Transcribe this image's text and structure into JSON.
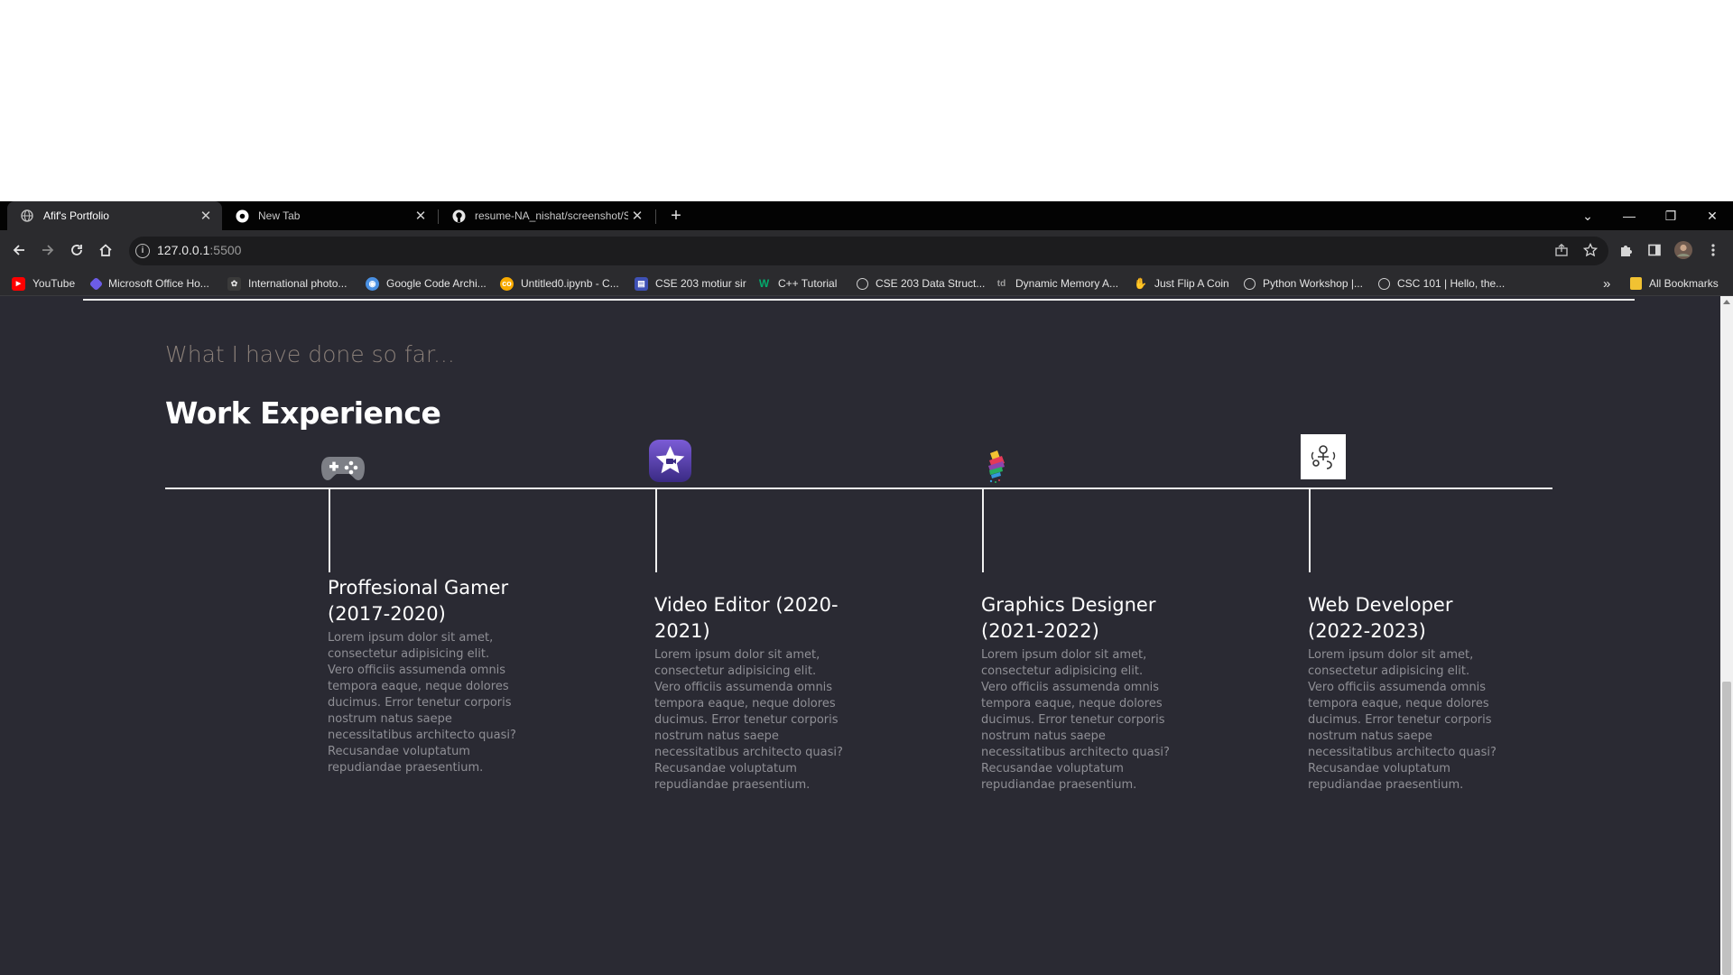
{
  "browser": {
    "tabs": [
      {
        "label": "Afif's Portfolio",
        "icon": "globe-icon",
        "active": true
      },
      {
        "label": "New Tab",
        "icon": "chrome-icon",
        "active": false
      },
      {
        "label": "resume-NA_nishat/screenshot/S",
        "icon": "github-icon",
        "active": false
      }
    ],
    "new_tab_symbol": "+",
    "window_controls": {
      "tab_search": "⌄",
      "minimize": "—",
      "restore": "❐",
      "close": "✕"
    },
    "url_host": "127.0.0.1",
    "url_port": ":5500",
    "bookmarks": [
      {
        "label": "YouTube",
        "icon": "youtube-icon",
        "color": "#ff0000"
      },
      {
        "label": "Microsoft Office Ho...",
        "icon": "office-icon",
        "color": "#6c5ce7"
      },
      {
        "label": "International photo...",
        "icon": "photo-icon",
        "color": "#444444"
      },
      {
        "label": "Google Code Archi...",
        "icon": "code-archive-icon",
        "color": "#4a90e2"
      },
      {
        "label": "Untitled0.ipynb - C...",
        "icon": "colab-icon",
        "color": "#f9ab00"
      },
      {
        "label": "CSE 203 motiur sir",
        "icon": "doc-icon",
        "color": "#3f51b5"
      },
      {
        "label": "C++ Tutorial",
        "icon": "w3-icon",
        "color": "#04aa6d"
      },
      {
        "label": "CSE 203 Data Struct...",
        "icon": "globe-icon",
        "color": "#cfcfcf"
      },
      {
        "label": "Dynamic Memory A...",
        "icon": "td-icon",
        "color": "#9e9e9e"
      },
      {
        "label": "Just Flip A Coin",
        "icon": "coin-icon",
        "color": "#f5b041"
      },
      {
        "label": "Python Workshop |...",
        "icon": "globe-icon",
        "color": "#cfcfcf"
      },
      {
        "label": "CSC 101 | Hello, the...",
        "icon": "globe-icon",
        "color": "#cfcfcf"
      }
    ],
    "bookmarks_overflow": "»",
    "all_bookmarks": "All Bookmarks"
  },
  "page": {
    "subtitle": "What I have done so far...",
    "title": "Work Experience",
    "experiences": [
      {
        "role_line1": "Proffesional Gamer",
        "role_line2": "(2017-2020)",
        "icon": "gamepad-icon",
        "description": "Lorem ipsum dolor sit amet, consectetur adipisicing elit. Vero officiis assumenda omnis tempora eaque, neque dolores ducimus. Error tenetur corporis nostrum natus saepe necessitatibus architecto quasi? Recusandae voluptatum repudiandae praesentium."
      },
      {
        "role_line1": "Video Editor (2020-",
        "role_line2": "2021)",
        "icon": "video-star-icon",
        "description": "Lorem ipsum dolor sit amet, consectetur adipisicing elit. Vero officiis assumenda omnis tempora eaque, neque dolores ducimus. Error tenetur corporis nostrum natus saepe necessitatibus architecto quasi? Recusandae voluptatum repudiandae praesentium."
      },
      {
        "role_line1": "Graphics Designer",
        "role_line2": "(2021-2022)",
        "icon": "paint-brush-icon",
        "description": "Lorem ipsum dolor sit amet, consectetur adipisicing elit. Vero officiis assumenda omnis tempora eaque, neque dolores ducimus. Error tenetur corporis nostrum natus saepe necessitatibus architecto quasi? Recusandae voluptatum repudiandae praesentium."
      },
      {
        "role_line1": "Web Developer",
        "role_line2": "(2022-2023)",
        "icon": "web-dev-icon",
        "description": "Lorem ipsum dolor sit amet, consectetur adipisicing elit. Vero officiis assumenda omnis tempora eaque, neque dolores ducimus. Error tenetur corporis nostrum natus saepe necessitatibus architecto quasi? Recusandae voluptatum repudiandae praesentium."
      }
    ]
  }
}
